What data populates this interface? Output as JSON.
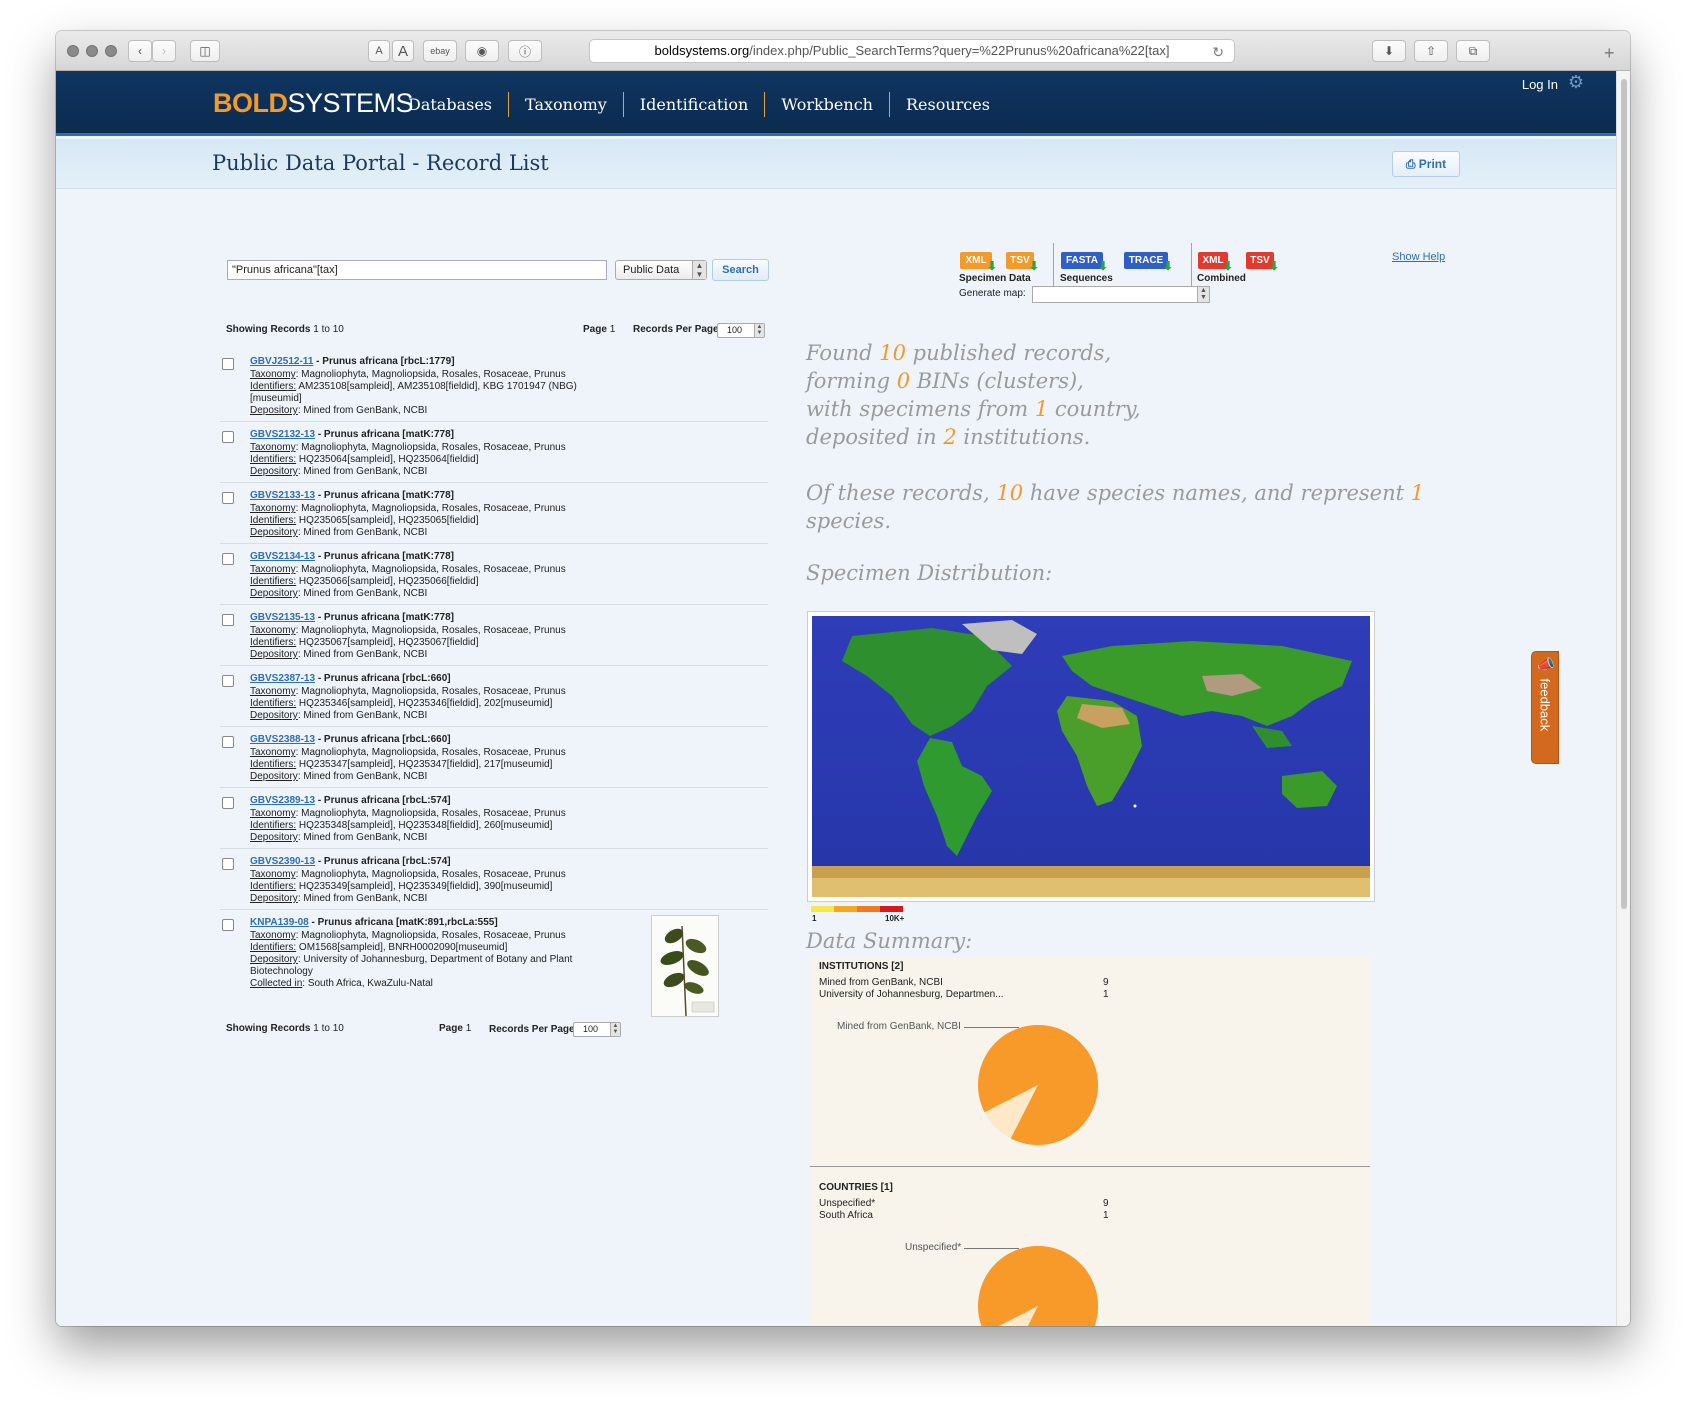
{
  "browser": {
    "address_domain": "boldsystems.org",
    "address_path": "/index.php/Public_SearchTerms?query=%22Prunus%20africana%22[tax]",
    "reader_small": "A",
    "reader_large": "A",
    "ebay": "ebay"
  },
  "header": {
    "logo_bold": "BOLD",
    "logo_systems": "SYSTEMS",
    "nav": [
      "Databases",
      "Taxonomy",
      "Identification",
      "Workbench",
      "Resources"
    ],
    "login": "Log In"
  },
  "titlebar": {
    "title": "Public Data Portal - Record List",
    "print_label": "Print"
  },
  "search": {
    "query": "\"Prunus africana\"[tax]",
    "database": "Public Data",
    "button": "Search"
  },
  "downloads": {
    "specimen": {
      "xml": "XML",
      "tsv": "TSV",
      "label": "Specimen Data"
    },
    "sequences": {
      "fasta": "FASTA",
      "trace": "TRACE",
      "label": "Sequences"
    },
    "combined": {
      "xml": "XML",
      "tsv": "TSV",
      "label": "Combined"
    },
    "generate_map": "Generate map:",
    "show_help": "Show Help"
  },
  "paging": {
    "showing_label": "Showing Records",
    "showing_range": "1 to 10",
    "page_label": "Page",
    "page_value": "1",
    "rpp_label": "Records Per Page",
    "rpp_value": "100"
  },
  "field_labels": {
    "taxonomy": "Taxonomy",
    "identifiers": "Identifiers:",
    "depository": "Depository",
    "collected": "Collected in"
  },
  "records": [
    {
      "id": "GBVJ2512-11",
      "title": " - Prunus africana [rbcL:1779]",
      "taxonomy": ": Magnoliophyta, Magnoliopsida, Rosales, Rosaceae, Prunus",
      "identifiers": " AM235108[sampleid], AM235108[fieldid], KBG 1701947 (NBG)",
      "identifiers_cont": "[museumid]",
      "depository": ": Mined from GenBank, NCBI"
    },
    {
      "id": "GBVS2132-13",
      "title": " - Prunus africana [matK:778]",
      "taxonomy": ": Magnoliophyta, Magnoliopsida, Rosales, Rosaceae, Prunus",
      "identifiers": " HQ235064[sampleid], HQ235064[fieldid]",
      "depository": ": Mined from GenBank, NCBI"
    },
    {
      "id": "GBVS2133-13",
      "title": " - Prunus africana [matK:778]",
      "taxonomy": ": Magnoliophyta, Magnoliopsida, Rosales, Rosaceae, Prunus",
      "identifiers": " HQ235065[sampleid], HQ235065[fieldid]",
      "depository": ": Mined from GenBank, NCBI"
    },
    {
      "id": "GBVS2134-13",
      "title": " - Prunus africana [matK:778]",
      "taxonomy": ": Magnoliophyta, Magnoliopsida, Rosales, Rosaceae, Prunus",
      "identifiers": " HQ235066[sampleid], HQ235066[fieldid]",
      "depository": ": Mined from GenBank, NCBI"
    },
    {
      "id": "GBVS2135-13",
      "title": " - Prunus africana [matK:778]",
      "taxonomy": ": Magnoliophyta, Magnoliopsida, Rosales, Rosaceae, Prunus",
      "identifiers": " HQ235067[sampleid], HQ235067[fieldid]",
      "depository": ": Mined from GenBank, NCBI"
    },
    {
      "id": "GBVS2387-13",
      "title": " - Prunus africana [rbcL:660]",
      "taxonomy": ": Magnoliophyta, Magnoliopsida, Rosales, Rosaceae, Prunus",
      "identifiers": " HQ235346[sampleid], HQ235346[fieldid], 202[museumid]",
      "depository": ": Mined from GenBank, NCBI"
    },
    {
      "id": "GBVS2388-13",
      "title": " - Prunus africana [rbcL:660]",
      "taxonomy": ": Magnoliophyta, Magnoliopsida, Rosales, Rosaceae, Prunus",
      "identifiers": " HQ235347[sampleid], HQ235347[fieldid], 217[museumid]",
      "depository": ": Mined from GenBank, NCBI"
    },
    {
      "id": "GBVS2389-13",
      "title": " - Prunus africana [rbcL:574]",
      "taxonomy": ": Magnoliophyta, Magnoliopsida, Rosales, Rosaceae, Prunus",
      "identifiers": " HQ235348[sampleid], HQ235348[fieldid], 260[museumid]",
      "depository": ": Mined from GenBank, NCBI"
    },
    {
      "id": "GBVS2390-13",
      "title": " - Prunus africana [rbcL:574]",
      "taxonomy": ": Magnoliophyta, Magnoliopsida, Rosales, Rosaceae, Prunus",
      "identifiers": " HQ235349[sampleid], HQ235349[fieldid], 390[museumid]",
      "depository": ": Mined from GenBank, NCBI"
    },
    {
      "id": "KNPA139-08",
      "title": " - Prunus africana [matK:891,rbcLa:555]",
      "taxonomy": ": Magnoliophyta, Magnoliopsida, Rosales, Rosaceae, Prunus",
      "identifiers": " OM1568[sampleid], BNRH0002090[museumid]",
      "depository": ": University of Johannesburg, Department of Botany and Plant",
      "depository_cont": "Biotechnology",
      "collected": ": South Africa, KwaZulu-Natal"
    }
  ],
  "summary": {
    "l1a": "Found ",
    "l1n": "10",
    "l1b": " published records,",
    "l2a": "forming ",
    "l2n": "0",
    "l2b": " BINs (clusters),",
    "l3a": "with specimens from ",
    "l3n": "1",
    "l3b": " country,",
    "l4a": "deposited in ",
    "l4n": "2",
    "l4b": " institutions.",
    "p2a": "Of these records, ",
    "p2n1": "10",
    "p2b": " have species names, and represent ",
    "p2n2": "1",
    "p2c": " species."
  },
  "distribution": {
    "title": "Specimen Distribution:",
    "legend_min": "1",
    "legend_max": "10K+",
    "legend_colors": [
      "#f7e84a",
      "#f5a623",
      "#ef7a22",
      "#e84b1e",
      "#d7191c"
    ]
  },
  "data_summary": {
    "title": "Data Summary:",
    "institutions_header": "INSTITUTIONS [2]",
    "institutions": [
      {
        "name": "Mined from GenBank, NCBI",
        "count": "9"
      },
      {
        "name": "University of Johannesburg, Departmen...",
        "count": "1"
      }
    ],
    "institutions_pie_label": "Mined from GenBank, NCBI",
    "countries_header": "COUNTRIES [1]",
    "countries": [
      {
        "name": "Unspecified*",
        "count": "9"
      },
      {
        "name": "South Africa",
        "count": "1"
      }
    ],
    "countries_pie_label": "Unspecified*",
    "pie_colors": {
      "major": "#f89a2a",
      "minor": "#fde8c8"
    }
  },
  "feedback": {
    "label": "feedback"
  }
}
